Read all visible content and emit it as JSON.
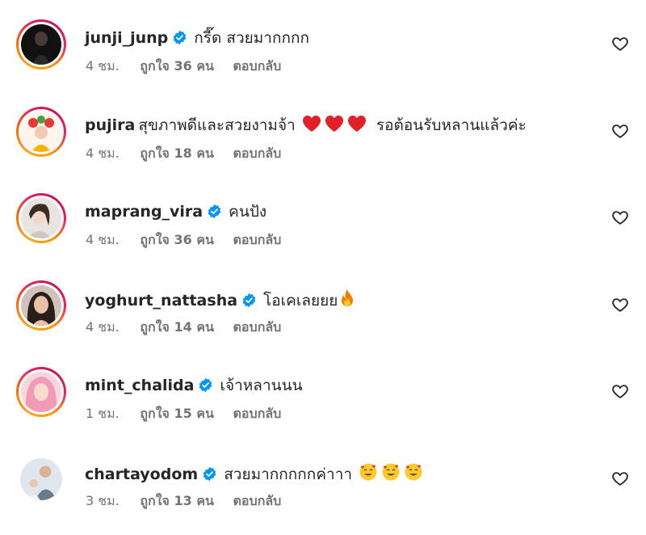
{
  "comments": [
    {
      "username": "junji_junp",
      "verified": true,
      "text": "กรี๊ด สวยมากกกก",
      "emojis": [],
      "time": "4 ชม.",
      "likes": "ถูกใจ 36 คน",
      "reply": "ตอบกลับ",
      "avatar_color": "#1a1a1a"
    },
    {
      "username": "pujira",
      "verified": false,
      "text": "สุขภาพดีและสวยงามจ้า",
      "emojis": [
        "heart",
        "heart",
        "heart"
      ],
      "text_after": "รอต้อนรับหลานแล้วค่ะ",
      "time": "4 ชม.",
      "likes": "ถูกใจ 18 คน",
      "reply": "ตอบกลับ",
      "avatar_color": "#f3c7b5"
    },
    {
      "username": "maprang_vira",
      "verified": true,
      "text": "คนปัง",
      "emojis": [],
      "time": "4 ชม.",
      "likes": "ถูกใจ 36 คน",
      "reply": "ตอบกลับ",
      "avatar_color": "#d9d2cc"
    },
    {
      "username": "yoghurt_nattasha",
      "verified": true,
      "text": "โอเคเลยยย",
      "emojis": [
        "fire"
      ],
      "time": "4 ชม.",
      "likes": "ถูกใจ 14 คน",
      "reply": "ตอบกลับ",
      "avatar_color": "#3b2a24"
    },
    {
      "username": "mint_chalida",
      "verified": true,
      "text": "เจ้าหลานนน",
      "emojis": [],
      "time": "1 ชม.",
      "likes": "ถูกใจ 15 คน",
      "reply": "ตอบกลับ",
      "avatar_color": "#f5a9c0"
    },
    {
      "username": "chartayodom",
      "verified": true,
      "text": "สวยมากกกกกค่าาา",
      "emojis": [
        "smiling-hearts",
        "smiling-hearts",
        "smiling-hearts"
      ],
      "time": "3 ชม.",
      "likes": "ถูกใจ 13 คน",
      "reply": "ตอบกลับ",
      "avatar_color": "#9fb3c8"
    }
  ],
  "colors": {
    "verified": "#0095f6",
    "meta_text": "#737373",
    "text": "#262626"
  }
}
